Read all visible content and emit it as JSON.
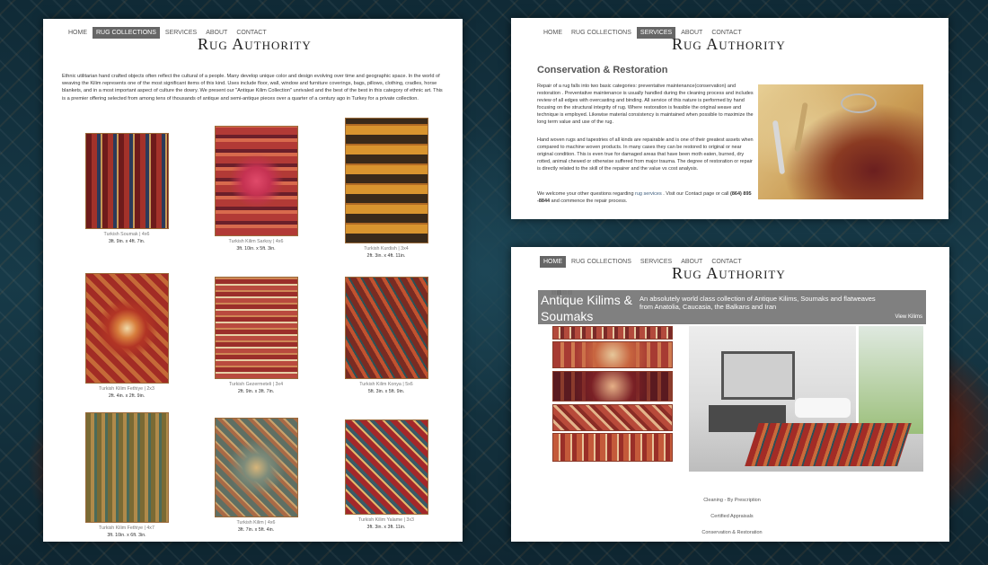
{
  "logo": "Rug Authority",
  "left": {
    "nav": [
      "HOME",
      "RUG COLLECTIONS",
      "SERVICES",
      "ABOUT",
      "CONTACT"
    ],
    "active": "RUG COLLECTIONS",
    "intro": "Ethnic utilitarian hand crafted objects often reflect the cultural of a people. Many develop unique color and design evolving over time and geographic space. In the world of weaving the Kilim represents one of the most significant items of this kind. Uses include floor, wall, window and furniture coverings, bags, pillows, clothing, cradles, horse blankets, and in a most important aspect of culture the dowry. We present our \"Antique Kilim Collection\" unrivaled and the best of the best in this category of ethnic art. This is a premier offering selected from among tens of thousands of antique and semi-antique pieces over a quarter of a century ago in Turkey for a private collection.",
    "items": [
      {
        "title": "Turkish Soumak | 4x6",
        "size": "3ft. 9in. x 4ft. 7in."
      },
      {
        "title": "Turkish Kilim Sarkoy | 4x6",
        "size": "3ft. 10in. x 5ft. 3in."
      },
      {
        "title": "Turkish Kurdish | 3x4",
        "size": "2ft. 3in. x 4ft. 11in."
      },
      {
        "title": "Turkish Kilim Fethiye | 2x3",
        "size": "2ft. 4in. x 2ft. 9in."
      },
      {
        "title": "Turkish Gezermeteli | 3x4",
        "size": "2ft. 9in. x 3ft. 7in."
      },
      {
        "title": "Turkish Kilim Konya | 5x6",
        "size": "5ft. 3in. x 5ft. 9in."
      },
      {
        "title": "Turkish Kilim Fethiye | 4x7",
        "size": "3ft. 10in. x 6ft. 3in."
      },
      {
        "title": "Turkish Kilim | 4x6",
        "size": "3ft. 7in. x 5ft. 4in."
      },
      {
        "title": "Turkish Kilim Yalame | 3x3",
        "size": "3ft. 3in. x 3ft. 11in."
      }
    ]
  },
  "topright": {
    "nav": [
      "HOME",
      "RUG COLLECTIONS",
      "SERVICES",
      "ABOUT",
      "CONTACT"
    ],
    "active": "SERVICES",
    "heading": "Conservation & Restoration",
    "p1": "Repair of a rug falls into two basic categories: preventative maintenance(conservation) and restoration . Preventative maintenance is usually handled during the cleaning process and includes review of all edges with overcasting and binding. All service of this nature is performed by hand focusing on the structural integrity of rug. Where restoration is feasible the original weave and technique is employed. Likewise material consistency is maintained when possible to maximize the long term value and use of the rug.",
    "p2": "Hand woven rugs and tapestries of all kinds are repairable and is one of their greatest assets when compared to machine woven products. In many cases they can be restored to original or near original condition. This is even true for damaged areas that have been moth eaten, burned, dry rotted, animal chewed or otherwise suffered from major trauma. The degree of restoration or repair is directly related to the skill of the repairer and the value vs cost analysis.",
    "p3a": "We welcome your other questions regarding ",
    "p3link": "rug services",
    "p3b": " . Visit our Contact page or call ",
    "phone": "(864) 895 -8844",
    "p3c": " and commence the repair process."
  },
  "bottomright": {
    "nav": [
      "HOME",
      "RUG COLLECTIONS",
      "SERVICES",
      "ABOUT",
      "CONTACT"
    ],
    "active": "HOME",
    "slides": [
      "1",
      "2",
      "3",
      "4"
    ],
    "banner_title": "Antique Kilims & Soumaks",
    "banner_text": "An absolutely world class collection of Antique Kilims, Soumaks and flatweaves from Anatolia, Caucasia, the Balkans and Iran",
    "banner_link": "View Kilims",
    "links": [
      "Cleaning - By Prescription",
      "Certified Appraisals",
      "Conservation & Restoration"
    ]
  }
}
